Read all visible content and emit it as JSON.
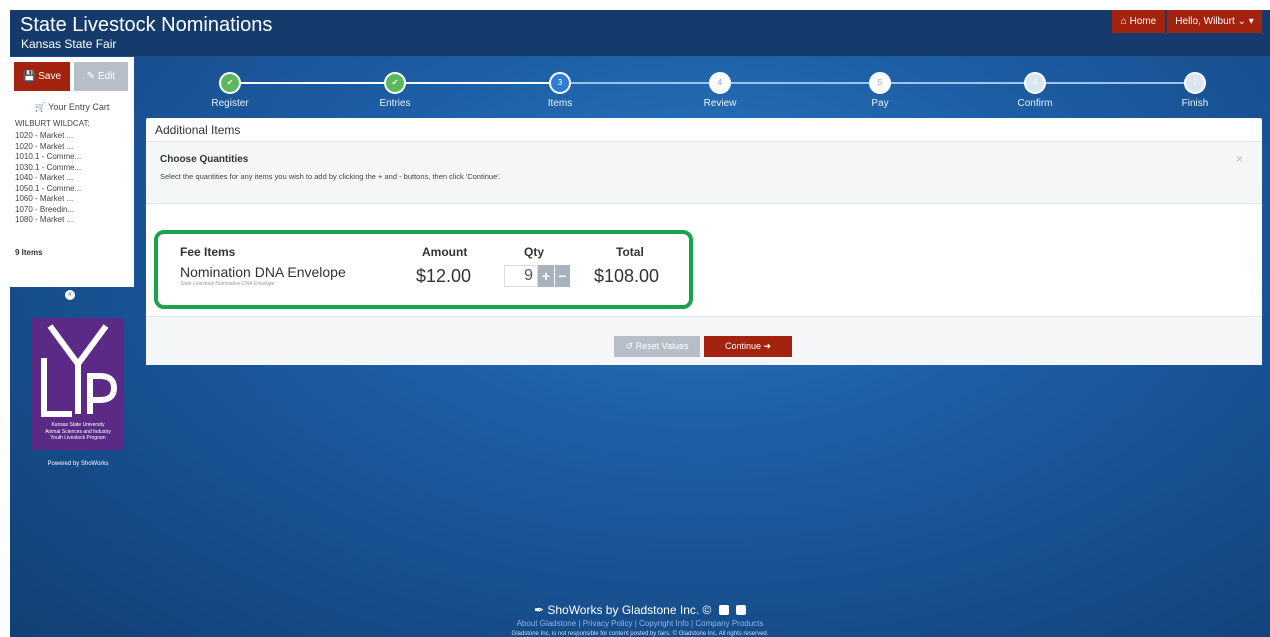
{
  "header": {
    "title": "State Livestock Nominations",
    "subtitle": "Kansas State Fair",
    "home_label": "Home",
    "user_label": "Hello, Wilburt"
  },
  "sidebar": {
    "save_label": "Save",
    "edit_label": "Edit",
    "cart_title": "Your Entry Cart",
    "owner": "WILBURT WILDCAT:",
    "items": [
      "1020 - Market ...",
      "1020 - Market ...",
      "1010.1 - Comme...",
      "1030.1 - Comme...",
      "1040 - Market ...",
      "1050.1 - Comme...",
      "1060 - Market ...",
      "1070 - Breedin...",
      "1080 - Market ..."
    ],
    "total": "9 Items",
    "logo_caption": [
      "Kansas State University",
      "Animal Sciences and Industry",
      "Youth Livestock Program"
    ],
    "powered_by": "Powered by ShoWorks"
  },
  "steps": [
    {
      "num": "",
      "label": "Register",
      "state": "done"
    },
    {
      "num": "",
      "label": "Entries",
      "state": "done"
    },
    {
      "num": "3",
      "label": "Items",
      "state": "current"
    },
    {
      "num": "4",
      "label": "Review",
      "state": "future"
    },
    {
      "num": "5",
      "label": "Pay",
      "state": "future"
    },
    {
      "num": "6",
      "label": "Confirm",
      "state": "faded"
    },
    {
      "num": "7",
      "label": "Finish",
      "state": "faded"
    }
  ],
  "panel": {
    "title": "Additional Items",
    "notice_title": "Choose Quantities",
    "notice_text": "Select the quantities for any items you wish to add by clicking the + and - buttons, then click 'Continue'.",
    "close_label": "×",
    "fee_header": "Fee Items",
    "amount_header": "Amount",
    "qty_header": "Qty",
    "total_header": "Total",
    "item_name": "Nomination DNA Envelope",
    "item_desc": "State Livestock Nomination DNA Envelope",
    "amount": "$12.00",
    "qty": "9",
    "total": "$108.00",
    "reset_label": "Reset Values",
    "continue_label": "Continue"
  },
  "footer": {
    "brand": "ShoWorks by Gladstone Inc. ©",
    "links": "About Gladstone | Privacy Policy | Copyright Info | Company Products",
    "legal": "Gladstone Inc. is not responsible for content posted by fairs. © Gladstone Inc. All rights reserved."
  },
  "colors": {
    "accent_red": "#a3230f",
    "highlight_green": "#1aa34a",
    "step_done": "#5cb85c",
    "background_blue": "#1d5fa6"
  }
}
